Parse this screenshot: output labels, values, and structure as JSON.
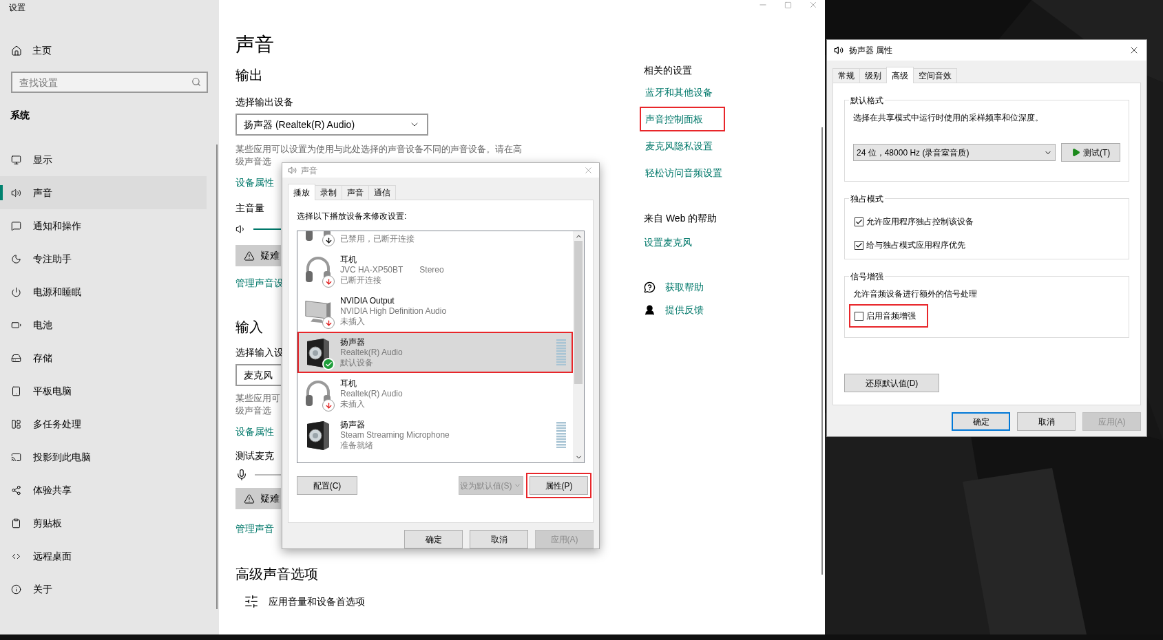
{
  "settings": {
    "app_title": "设置",
    "sidebar": {
      "home": "主页",
      "search": {
        "placeholder": "查找设置"
      },
      "section": "系统",
      "items": [
        {
          "label": "显示",
          "selected": false
        },
        {
          "label": "声音",
          "selected": true
        },
        {
          "label": "通知和操作",
          "selected": false
        },
        {
          "label": "专注助手",
          "selected": false
        },
        {
          "label": "电源和睡眠",
          "selected": false
        },
        {
          "label": "电池",
          "selected": false
        },
        {
          "label": "存储",
          "selected": false
        },
        {
          "label": "平板电脑",
          "selected": false
        },
        {
          "label": "多任务处理",
          "selected": false
        },
        {
          "label": "投影到此电脑",
          "selected": false
        },
        {
          "label": "体验共享",
          "selected": false
        },
        {
          "label": "剪贴板",
          "selected": false
        },
        {
          "label": "远程桌面",
          "selected": false
        },
        {
          "label": "关于",
          "selected": false
        }
      ]
    },
    "main": {
      "title": "声音",
      "output": {
        "heading": "输出",
        "device_label": "选择输出设备",
        "device_value": "扬声器 (Realtek(R) Audio)",
        "description": [
          "某些应用可以设置为使用与此处选择的声音设备不同的声音设备。请在高",
          "级声音选"
        ],
        "device_properties": "设备属性",
        "volume_label": "主音量",
        "troubleshoot": "疑难",
        "manage": "管理声音设"
      },
      "input": {
        "heading": "输入",
        "device_label": "选择输入设",
        "device_value": "麦克风",
        "description": [
          "某些应用可",
          "级声音选"
        ],
        "device_properties": "设备属性",
        "test_label": "测试麦克",
        "troubleshoot": "疑难",
        "manage": "管理声音"
      },
      "advanced": {
        "heading": "高级声音选项",
        "item": "应用音量和设备首选项"
      }
    },
    "related": {
      "heading": "相关的设置",
      "links": [
        {
          "label": "蓝牙和其他设备",
          "highlighted": false
        },
        {
          "label": "声音控制面板",
          "highlighted": true
        },
        {
          "label": "麦克风隐私设置",
          "highlighted": false
        },
        {
          "label": "轻松访问音频设置",
          "highlighted": false
        }
      ]
    },
    "web_help": {
      "heading": "来自 Web 的帮助",
      "links": [
        "设置麦克风"
      ]
    },
    "help_links": [
      "获取帮助",
      "提供反馈"
    ]
  },
  "sound_dialog": {
    "title": "声音",
    "tabs": [
      {
        "label": "播放",
        "selected": true
      },
      {
        "label": "录制",
        "selected": false
      },
      {
        "label": "声音",
        "selected": false
      },
      {
        "label": "通信",
        "selected": false
      }
    ],
    "instruction": "选择以下播放设备来修改设置:",
    "devices": [
      {
        "kind": "headphones",
        "status": "已禁用，已断开连接",
        "default": false,
        "unavailable": true,
        "disabled": true,
        "selected": false,
        "highlighted": false,
        "meter": false
      },
      {
        "kind": "headphones",
        "name": "耳机",
        "detail": "JVC HA-XP50BT",
        "detail_extra": "Stereo",
        "status": "已断开连接",
        "default": false,
        "unavailable": true,
        "disabled": false,
        "selected": false,
        "highlighted": false,
        "meter": false
      },
      {
        "kind": "monitor",
        "name": "NVIDIA Output",
        "detail": "NVIDIA High Definition Audio",
        "status": "未插入",
        "default": false,
        "unavailable": true,
        "disabled": false,
        "selected": false,
        "highlighted": false,
        "meter": false
      },
      {
        "kind": "speaker",
        "name": "扬声器",
        "detail": "Realtek(R) Audio",
        "status": "默认设备",
        "default": true,
        "unavailable": false,
        "selected": true,
        "highlighted": true,
        "meter": true
      },
      {
        "kind": "headphones",
        "name": "耳机",
        "detail": "Realtek(R) Audio",
        "status": "未插入",
        "default": false,
        "unavailable": true,
        "disabled": false,
        "selected": false,
        "highlighted": false,
        "meter": false
      },
      {
        "kind": "speaker",
        "name": "扬声器",
        "detail": "Steam Streaming Microphone",
        "status": "准备就绪",
        "default": false,
        "unavailable": false,
        "selected": false,
        "highlighted": false,
        "meter": true
      }
    ],
    "configure": "配置(C)",
    "set_default": {
      "label": "设为默认值(S)",
      "disabled": true
    },
    "properties": {
      "label": "属性(P)",
      "highlighted": true
    },
    "buttons": [
      {
        "label": "确定",
        "disabled": false
      },
      {
        "label": "取消",
        "disabled": false
      },
      {
        "label": "应用(A)",
        "disabled": true
      }
    ]
  },
  "properties_dialog": {
    "title": "扬声器 属性",
    "tabs": [
      {
        "label": "常规",
        "selected": false
      },
      {
        "label": "级别",
        "selected": false
      },
      {
        "label": "高级",
        "selected": true
      },
      {
        "label": "空间音效",
        "selected": false
      }
    ],
    "default_format": {
      "title": "默认格式",
      "description": "选择在共享模式中运行时使用的采样频率和位深度。",
      "format": "24 位，48000 Hz (录音室音质)",
      "test_button": "测试(T)"
    },
    "exclusive": {
      "title": "独占模式",
      "options": [
        {
          "label": "允许应用程序独占控制该设备",
          "checked": true,
          "highlighted": false
        },
        {
          "label": "给与独占模式应用程序优先",
          "checked": true,
          "highlighted": false
        }
      ]
    },
    "enhancement": {
      "title": "信号增强",
      "description": "允许音频设备进行额外的信号处理",
      "options": [
        {
          "label": "启用音频增强",
          "checked": false,
          "highlighted": true
        }
      ]
    },
    "restore_button": "还原默认值(D)",
    "buttons": [
      {
        "label": "确定",
        "default": true,
        "disabled": false
      },
      {
        "label": "取消",
        "default": false,
        "disabled": false
      },
      {
        "label": "应用(A)",
        "default": false,
        "disabled": true
      }
    ]
  }
}
